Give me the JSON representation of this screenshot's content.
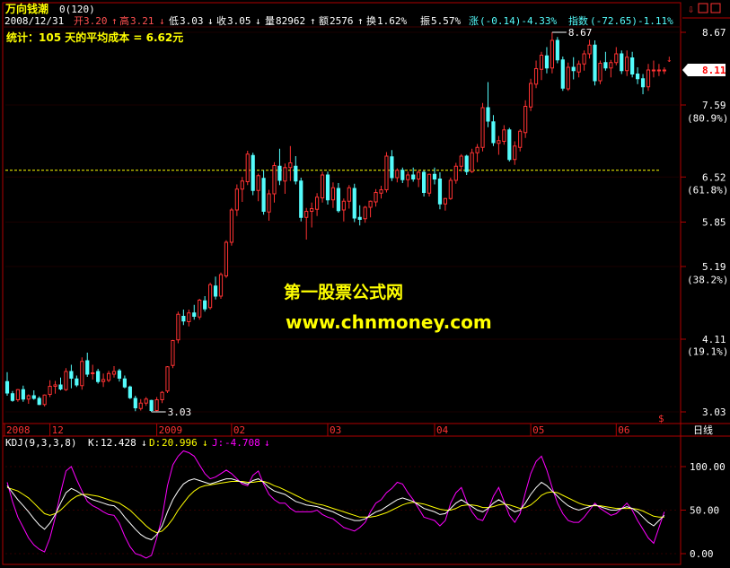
{
  "header": {
    "stock_name": "万向钱潮",
    "stock_code": "0(120)",
    "date": "2008/12/31",
    "open_label": "开",
    "open_value": "3.20",
    "high_label": "高",
    "high_value": "3.21",
    "low_label": "低",
    "low_value": "3.03",
    "close_label": "收",
    "close_value": "3.05",
    "volume_label": "量",
    "volume_value": "82962",
    "amount_label": "额",
    "amount_value": "2576",
    "turnover_label": "换",
    "turnover_value": "1.62%",
    "amplitude_label": "振",
    "amplitude_value": "5.57%",
    "change_label": "涨",
    "change_value": "(-0.14)-4.33%",
    "index_label": "指数",
    "index_value": "(-72.65)-1.11%",
    "stats_line": "统计：105 天的平均成本 = 6.62元"
  },
  "watermark": {
    "line1": "第一股票公式网",
    "line2": "www.chnmoney.com"
  },
  "right_axis": {
    "price_labels": [
      {
        "value": 8.67,
        "text": "8.67"
      },
      {
        "value": 7.59,
        "text": "7.59"
      },
      {
        "value": 6.52,
        "text": "6.52"
      },
      {
        "value": 5.85,
        "text": "5.85"
      },
      {
        "value": 5.19,
        "text": "5.19"
      },
      {
        "value": 4.11,
        "text": "4.11"
      },
      {
        "value": 3.03,
        "text": "3.03"
      }
    ],
    "pct_labels": [
      {
        "value": 7.4,
        "text": "(80.9%)"
      },
      {
        "value": 6.33,
        "text": "(61.8%)"
      },
      {
        "value": 5.0,
        "text": "(38.2%)"
      },
      {
        "value": 3.93,
        "text": "(19.1%)"
      }
    ],
    "current_price": "8.11",
    "period_label": "日线"
  },
  "annotations": {
    "max_label": "8.67",
    "min_label": "3.03",
    "avg_cost": 6.62
  },
  "time_axis": {
    "labels": [
      {
        "index": 0,
        "text": "2008"
      },
      {
        "index": 8,
        "text": "12"
      },
      {
        "index": 28,
        "text": "2009"
      },
      {
        "index": 42,
        "text": "02"
      },
      {
        "index": 60,
        "text": "03"
      },
      {
        "index": 80,
        "text": "04"
      },
      {
        "index": 98,
        "text": "05"
      },
      {
        "index": 114,
        "text": "06"
      }
    ]
  },
  "indicator": {
    "name": "KDJ(9,3,3,8)",
    "k_label": "K:",
    "k_value": "12.428",
    "d_label": "D:",
    "d_value": "20.996",
    "j_label": "J:",
    "j_value": "-4.708",
    "axis_labels": [
      {
        "value": 100,
        "text": "100.00"
      },
      {
        "value": 50,
        "text": "50.00"
      },
      {
        "value": 0,
        "text": "0.00"
      }
    ],
    "colors": {
      "k": "#FFFFFF",
      "d": "#FFFF00",
      "j": "#FF00FF"
    }
  },
  "colors": {
    "up": "#FF3232",
    "down": "#54FCFC",
    "axis": "#B00000",
    "avg_line": "#FFFF00",
    "watermark": "#FFFF00",
    "header_red": "#FF5050",
    "header_cyan": "#54FCFC"
  },
  "chart_data": [
    {
      "type": "candlestick",
      "title": "",
      "ylim": [
        3.03,
        8.67
      ],
      "x_count": 124,
      "candles": [
        [
          3.48,
          3.62,
          3.27,
          3.31
        ],
        [
          3.3,
          3.34,
          3.18,
          3.2
        ],
        [
          3.21,
          3.37,
          3.18,
          3.36
        ],
        [
          3.36,
          3.42,
          3.18,
          3.22
        ],
        [
          3.22,
          3.29,
          3.15,
          3.27
        ],
        [
          3.27,
          3.35,
          3.21,
          3.23
        ],
        [
          3.23,
          3.26,
          3.13,
          3.14
        ],
        [
          3.14,
          3.29,
          3.11,
          3.28
        ],
        [
          3.29,
          3.5,
          3.25,
          3.41
        ],
        [
          3.41,
          3.49,
          3.3,
          3.43
        ],
        [
          3.43,
          3.54,
          3.35,
          3.37
        ],
        [
          3.36,
          3.68,
          3.34,
          3.63
        ],
        [
          3.63,
          3.73,
          3.38,
          3.53
        ],
        [
          3.52,
          3.57,
          3.4,
          3.43
        ],
        [
          3.42,
          3.84,
          3.36,
          3.78
        ],
        [
          3.79,
          3.91,
          3.55,
          3.59
        ],
        [
          3.6,
          3.73,
          3.51,
          3.61
        ],
        [
          3.63,
          3.67,
          3.45,
          3.48
        ],
        [
          3.48,
          3.6,
          3.4,
          3.51
        ],
        [
          3.5,
          3.64,
          3.47,
          3.6
        ],
        [
          3.59,
          3.71,
          3.54,
          3.63
        ],
        [
          3.64,
          3.67,
          3.48,
          3.53
        ],
        [
          3.52,
          3.57,
          3.38,
          3.4
        ],
        [
          3.4,
          3.42,
          3.22,
          3.24
        ],
        [
          3.23,
          3.27,
          3.04,
          3.09
        ],
        [
          3.08,
          3.22,
          3.05,
          3.16
        ],
        [
          3.16,
          3.25,
          3.12,
          3.22
        ],
        [
          3.2,
          3.21,
          3.03,
          3.05
        ],
        [
          3.05,
          3.25,
          3.04,
          3.21
        ],
        [
          3.21,
          3.34,
          3.16,
          3.32
        ],
        [
          3.34,
          3.71,
          3.31,
          3.7
        ],
        [
          3.72,
          4.1,
          3.68,
          4.09
        ],
        [
          4.1,
          4.52,
          4.05,
          4.48
        ],
        [
          4.45,
          4.55,
          4.32,
          4.38
        ],
        [
          4.37,
          4.55,
          4.3,
          4.5
        ],
        [
          4.5,
          4.62,
          4.4,
          4.45
        ],
        [
          4.44,
          4.71,
          4.4,
          4.69
        ],
        [
          4.68,
          4.75,
          4.52,
          4.56
        ],
        [
          4.58,
          4.95,
          4.55,
          4.92
        ],
        [
          4.9,
          5.04,
          4.7,
          4.75
        ],
        [
          4.75,
          5.1,
          4.71,
          5.07
        ],
        [
          5.05,
          5.58,
          5.02,
          5.55
        ],
        [
          5.55,
          6.06,
          5.5,
          6.03
        ],
        [
          6.03,
          6.41,
          5.94,
          6.34
        ],
        [
          6.34,
          6.52,
          6.15,
          6.46
        ],
        [
          6.45,
          6.91,
          6.4,
          6.86
        ],
        [
          6.84,
          6.88,
          6.25,
          6.32
        ],
        [
          6.32,
          6.57,
          6.16,
          6.54
        ],
        [
          6.5,
          6.62,
          5.96,
          6.01
        ],
        [
          6.0,
          6.33,
          5.87,
          6.27
        ],
        [
          6.27,
          6.74,
          6.14,
          6.69
        ],
        [
          6.68,
          6.94,
          6.4,
          6.47
        ],
        [
          6.46,
          6.72,
          6.27,
          6.66
        ],
        [
          6.66,
          6.98,
          6.46,
          6.73
        ],
        [
          6.68,
          6.83,
          6.41,
          6.46
        ],
        [
          6.46,
          6.51,
          5.86,
          5.92
        ],
        [
          5.92,
          6.06,
          5.59,
          6.01
        ],
        [
          6.01,
          6.14,
          5.77,
          6.05
        ],
        [
          6.04,
          6.28,
          5.94,
          6.22
        ],
        [
          6.21,
          6.6,
          6.14,
          6.55
        ],
        [
          6.55,
          6.6,
          6.11,
          6.18
        ],
        [
          6.18,
          6.44,
          6.06,
          6.36
        ],
        [
          6.35,
          6.43,
          5.99,
          6.02
        ],
        [
          6.03,
          6.2,
          5.86,
          6.16
        ],
        [
          6.16,
          6.4,
          6.05,
          6.36
        ],
        [
          6.35,
          6.42,
          5.85,
          5.91
        ],
        [
          5.92,
          6.1,
          5.8,
          5.89
        ],
        [
          5.9,
          6.09,
          5.84,
          6.07
        ],
        [
          6.07,
          6.17,
          5.92,
          6.16
        ],
        [
          6.15,
          6.34,
          6.08,
          6.29
        ],
        [
          6.28,
          6.39,
          6.2,
          6.33
        ],
        [
          6.33,
          6.89,
          6.29,
          6.83
        ],
        [
          6.82,
          6.92,
          6.46,
          6.51
        ],
        [
          6.51,
          6.65,
          6.44,
          6.62
        ],
        [
          6.62,
          6.66,
          6.43,
          6.48
        ],
        [
          6.48,
          6.6,
          6.37,
          6.55
        ],
        [
          6.55,
          6.66,
          6.45,
          6.49
        ],
        [
          6.49,
          6.62,
          6.37,
          6.59
        ],
        [
          6.59,
          6.62,
          6.23,
          6.29
        ],
        [
          6.28,
          6.57,
          6.23,
          6.56
        ],
        [
          6.56,
          6.66,
          6.41,
          6.49
        ],
        [
          6.49,
          6.59,
          6.04,
          6.12
        ],
        [
          6.12,
          6.21,
          6.02,
          6.2
        ],
        [
          6.2,
          6.51,
          6.18,
          6.47
        ],
        [
          6.47,
          6.73,
          6.42,
          6.68
        ],
        [
          6.68,
          6.86,
          6.6,
          6.83
        ],
        [
          6.83,
          6.85,
          6.55,
          6.6
        ],
        [
          6.6,
          6.94,
          6.58,
          6.88
        ],
        [
          6.88,
          7.01,
          6.74,
          6.96
        ],
        [
          6.96,
          7.62,
          6.9,
          7.55
        ],
        [
          7.55,
          7.93,
          7.26,
          7.35
        ],
        [
          7.34,
          7.44,
          6.98,
          7.03
        ],
        [
          7.02,
          7.13,
          6.85,
          7.06
        ],
        [
          7.05,
          7.29,
          7.0,
          7.22
        ],
        [
          7.22,
          7.25,
          6.75,
          6.78
        ],
        [
          6.78,
          7.05,
          6.7,
          6.98
        ],
        [
          6.96,
          7.23,
          6.9,
          7.2
        ],
        [
          7.18,
          7.66,
          7.1,
          7.57
        ],
        [
          7.56,
          7.98,
          7.5,
          7.91
        ],
        [
          7.9,
          8.25,
          7.84,
          8.13
        ],
        [
          8.12,
          8.38,
          7.96,
          8.33
        ],
        [
          8.32,
          8.45,
          8.06,
          8.14
        ],
        [
          8.14,
          8.67,
          8.06,
          8.55
        ],
        [
          8.55,
          8.6,
          8.21,
          8.26
        ],
        [
          8.26,
          8.31,
          7.8,
          7.84
        ],
        [
          7.83,
          8.22,
          7.8,
          8.15
        ],
        [
          8.15,
          8.3,
          7.97,
          8.1
        ],
        [
          8.08,
          8.25,
          8.0,
          8.2
        ],
        [
          8.2,
          8.4,
          8.1,
          8.35
        ],
        [
          8.35,
          8.56,
          8.28,
          8.48
        ],
        [
          8.48,
          8.55,
          7.88,
          7.95
        ],
        [
          7.95,
          8.25,
          7.9,
          8.21
        ],
        [
          8.22,
          8.38,
          8.1,
          8.14
        ],
        [
          8.14,
          8.26,
          8.0,
          8.22
        ],
        [
          8.22,
          8.45,
          8.18,
          8.35
        ],
        [
          8.35,
          8.4,
          8.05,
          8.1
        ],
        [
          8.1,
          8.4,
          8.02,
          8.3
        ],
        [
          8.29,
          8.38,
          8.0,
          8.05
        ],
        [
          8.05,
          8.15,
          7.9,
          7.98
        ],
        [
          7.98,
          8.05,
          7.75,
          7.86
        ],
        [
          7.86,
          8.2,
          7.8,
          8.11
        ],
        [
          8.11,
          8.25,
          8.0,
          8.11
        ],
        [
          8.11,
          8.2,
          8.02,
          8.11
        ],
        [
          8.11,
          8.15,
          8.05,
          8.11
        ]
      ]
    },
    {
      "type": "line",
      "title": "KDJ(9,3,3,8)",
      "ylim": [
        0,
        115
      ],
      "x_count": 124,
      "series": [
        {
          "name": "K",
          "values": [
            78,
            70,
            62,
            55,
            48,
            40,
            33,
            28,
            35,
            45,
            58,
            70,
            75,
            72,
            68,
            65,
            62,
            60,
            58,
            56,
            55,
            50,
            42,
            35,
            28,
            22,
            18,
            16,
            22,
            32,
            48,
            62,
            72,
            80,
            84,
            86,
            84,
            82,
            80,
            82,
            84,
            86,
            86,
            84,
            82,
            80,
            84,
            86,
            82,
            76,
            72,
            70,
            68,
            64,
            60,
            58,
            56,
            55,
            54,
            52,
            50,
            48,
            45,
            42,
            40,
            38,
            38,
            40,
            44,
            48,
            50,
            54,
            58,
            62,
            64,
            62,
            60,
            56,
            52,
            50,
            48,
            45,
            46,
            52,
            58,
            62,
            58,
            54,
            50,
            48,
            52,
            58,
            62,
            58,
            52,
            48,
            50,
            58,
            68,
            76,
            82,
            78,
            72,
            66,
            60,
            55,
            52,
            50,
            52,
            54,
            56,
            54,
            52,
            50,
            50,
            52,
            54,
            52,
            48,
            42,
            36,
            32,
            38,
            44
          ]
        },
        {
          "name": "D",
          "values": [
            76,
            74,
            72,
            68,
            64,
            58,
            52,
            46,
            44,
            46,
            50,
            56,
            62,
            66,
            68,
            68,
            67,
            66,
            64,
            62,
            60,
            58,
            54,
            50,
            44,
            38,
            32,
            27,
            24,
            26,
            32,
            40,
            50,
            58,
            66,
            72,
            76,
            78,
            79,
            80,
            81,
            82,
            83,
            83,
            83,
            82,
            82,
            83,
            83,
            81,
            78,
            76,
            73,
            70,
            67,
            64,
            61,
            59,
            57,
            56,
            54,
            52,
            50,
            48,
            46,
            44,
            42,
            42,
            42,
            43,
            45,
            47,
            50,
            53,
            56,
            58,
            59,
            58,
            57,
            55,
            53,
            51,
            50,
            50,
            52,
            55,
            56,
            56,
            55,
            53,
            53,
            54,
            56,
            57,
            56,
            54,
            52,
            53,
            56,
            61,
            67,
            70,
            71,
            70,
            67,
            64,
            61,
            58,
            56,
            55,
            55,
            55,
            54,
            53,
            52,
            52,
            52,
            52,
            51,
            49,
            46,
            43,
            42,
            42
          ]
        },
        {
          "name": "J",
          "values": [
            82,
            60,
            42,
            30,
            18,
            10,
            5,
            2,
            18,
            42,
            70,
            95,
            100,
            85,
            72,
            60,
            55,
            52,
            48,
            45,
            44,
            35,
            20,
            8,
            0,
            -2,
            -5,
            -2,
            18,
            42,
            78,
            102,
            112,
            118,
            116,
            112,
            102,
            92,
            86,
            88,
            92,
            96,
            92,
            86,
            80,
            78,
            90,
            95,
            80,
            68,
            62,
            58,
            58,
            52,
            48,
            48,
            48,
            48,
            50,
            45,
            42,
            40,
            35,
            30,
            28,
            26,
            30,
            36,
            48,
            58,
            62,
            70,
            75,
            82,
            80,
            70,
            62,
            52,
            42,
            40,
            38,
            32,
            38,
            58,
            70,
            76,
            60,
            48,
            40,
            38,
            50,
            66,
            76,
            60,
            44,
            36,
            46,
            70,
            92,
            106,
            112,
            96,
            76,
            58,
            46,
            38,
            36,
            36,
            42,
            50,
            58,
            52,
            48,
            44,
            46,
            52,
            58,
            50,
            38,
            28,
            18,
            12,
            30,
            48
          ]
        }
      ],
      "axis_labels": [
        "100.00",
        "50.00",
        "0.00"
      ]
    }
  ]
}
